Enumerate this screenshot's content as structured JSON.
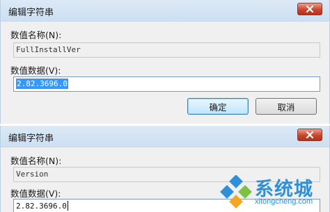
{
  "dialogs": [
    {
      "title": "编辑字符串",
      "value_name_label": "数值名称(N):",
      "value_name": "FullInstallVer",
      "value_data_label": "数值数据(V):",
      "value_data": "2.82.3696.0",
      "ok_label": "确定",
      "cancel_label": "取消"
    },
    {
      "title": "编辑字符串",
      "value_name_label": "数值名称(N):",
      "value_name": "Version",
      "value_data_label": "数值数据(V):",
      "value_data": "2.82.3696.0"
    }
  ],
  "watermark": {
    "brand": "系统城",
    "url": "xitongcheng.com"
  },
  "colors": {
    "titlebar": "#dce9f6",
    "close_button": "#c9452d",
    "selection": "#3399ff",
    "watermark": "#2f8fd8"
  }
}
